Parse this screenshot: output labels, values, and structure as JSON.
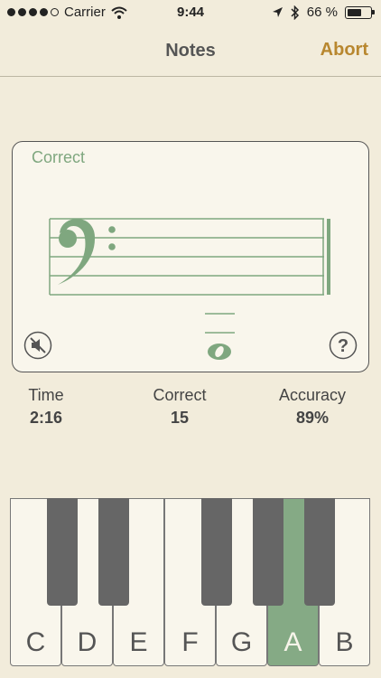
{
  "status_bar": {
    "carrier": "Carrier",
    "time": "9:44",
    "battery": "66 %",
    "battery_level": 0.66,
    "signal_bars": 4,
    "signal_total": 5
  },
  "nav": {
    "title": "Notes",
    "abort_label": "Abort"
  },
  "card": {
    "feedback": "Correct",
    "clef": "bass-clef-icon",
    "note": "whole-note-icon",
    "mute_icon": "speaker-muted-icon",
    "help_label": "?"
  },
  "stats": {
    "time": {
      "label": "Time",
      "value": "2:16"
    },
    "correct": {
      "label": "Correct",
      "value": "15"
    },
    "accuracy": {
      "label": "Accuracy",
      "value": "89%"
    }
  },
  "keyboard": {
    "white_keys": [
      "C",
      "D",
      "E",
      "F",
      "G",
      "A",
      "B"
    ],
    "active_key": "A"
  },
  "colors": {
    "background": "#f2ecdb",
    "accent": "#b8872f",
    "notation_green": "#7fa77f",
    "active_key": "#85aa85",
    "black_key": "#666666"
  }
}
